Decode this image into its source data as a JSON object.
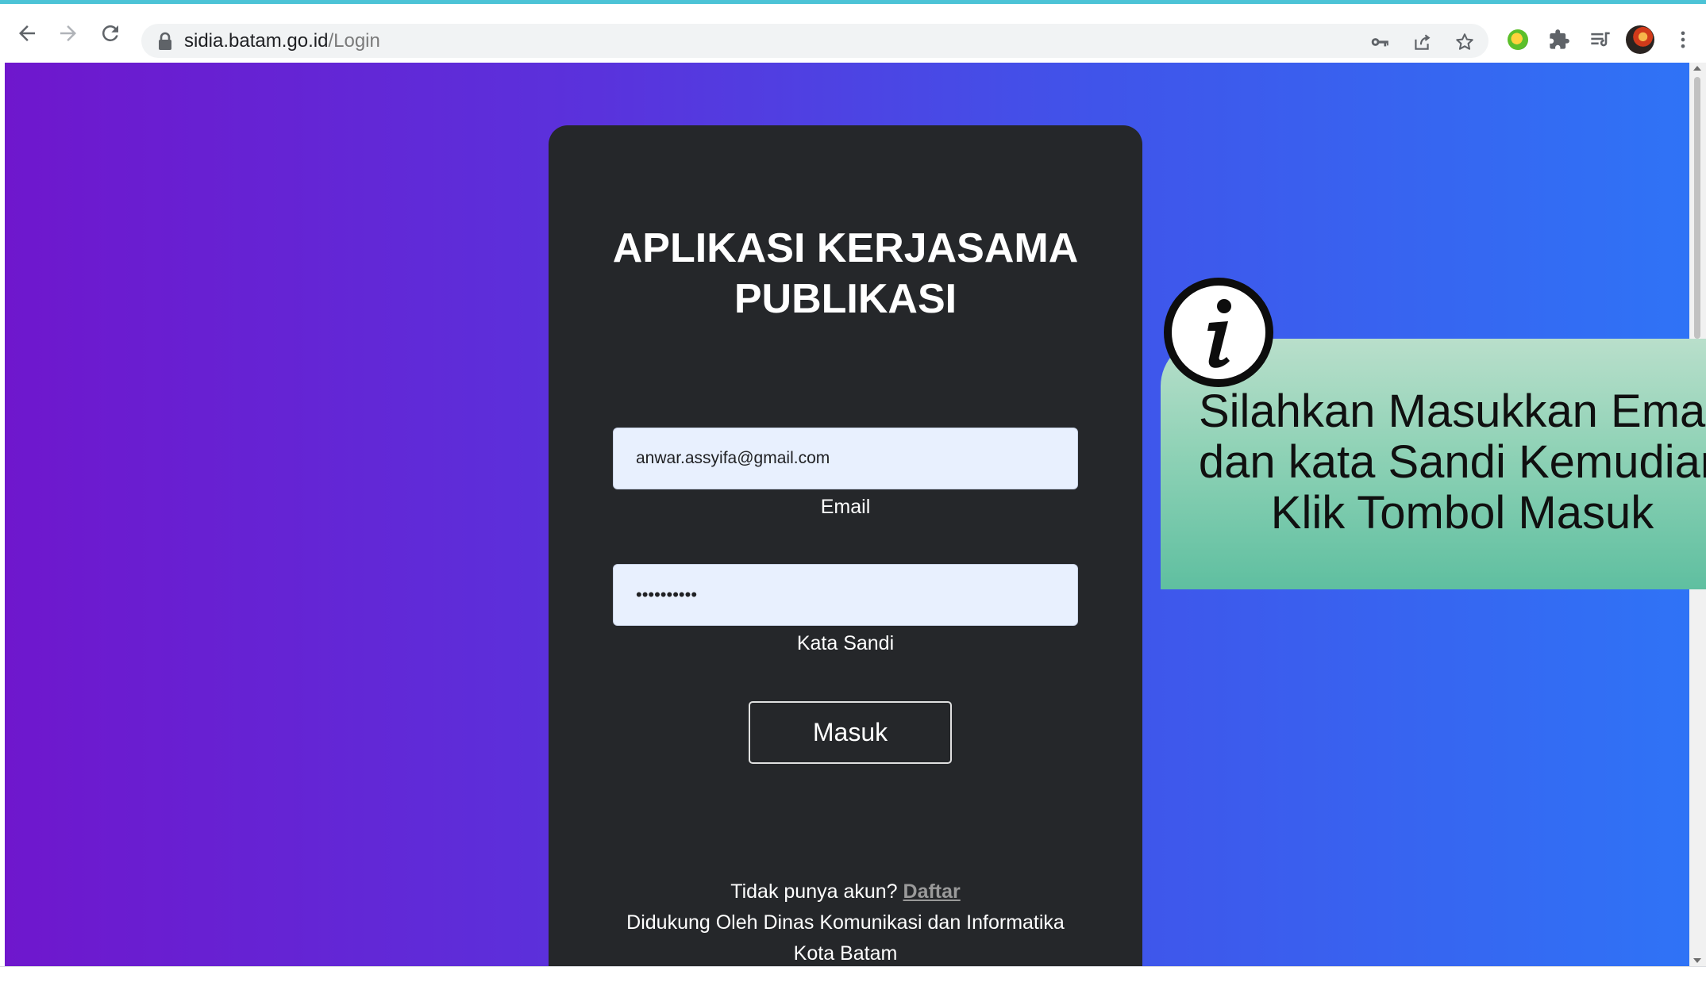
{
  "browser": {
    "url_domain": "sidia.batam.go.id",
    "url_path": "/Login",
    "icons": [
      "back-arrow-icon",
      "forward-arrow-icon",
      "reload-icon",
      "lock-icon",
      "key-icon",
      "share-icon",
      "star-icon",
      "extension-globe-icon",
      "puzzle-icon",
      "reading-list-icon",
      "profile-avatar",
      "more-vert-icon"
    ]
  },
  "login": {
    "title_line1": "APLIKASI KERJASAMA",
    "title_line2": "PUBLIKASI",
    "email_value": "anwar.assyifa@gmail.com",
    "email_label": "Email",
    "password_value": "••••••••••",
    "password_label": "Kata Sandi",
    "submit_label": "Masuk",
    "no_account_text": "Tidak punya akun?",
    "register_link": "Daftar",
    "support_line1": "Didukung Oleh Dinas Komunikasi dan Informatika",
    "support_line2": "Kota Batam"
  },
  "callout": {
    "line1": "Silahkan Masukkan Email",
    "line2": "dan kata Sandi Kemudian",
    "line3": "Klik Tombol Masuk",
    "icon": "info-icon"
  },
  "colors": {
    "accent_bar": "#4cc3d6",
    "gradient_start": "#6f17cd",
    "gradient_end": "#2f73f6",
    "card_bg": "#25272a",
    "input_bg": "#e8f0fe",
    "callout_green": "#5fbfa0"
  }
}
